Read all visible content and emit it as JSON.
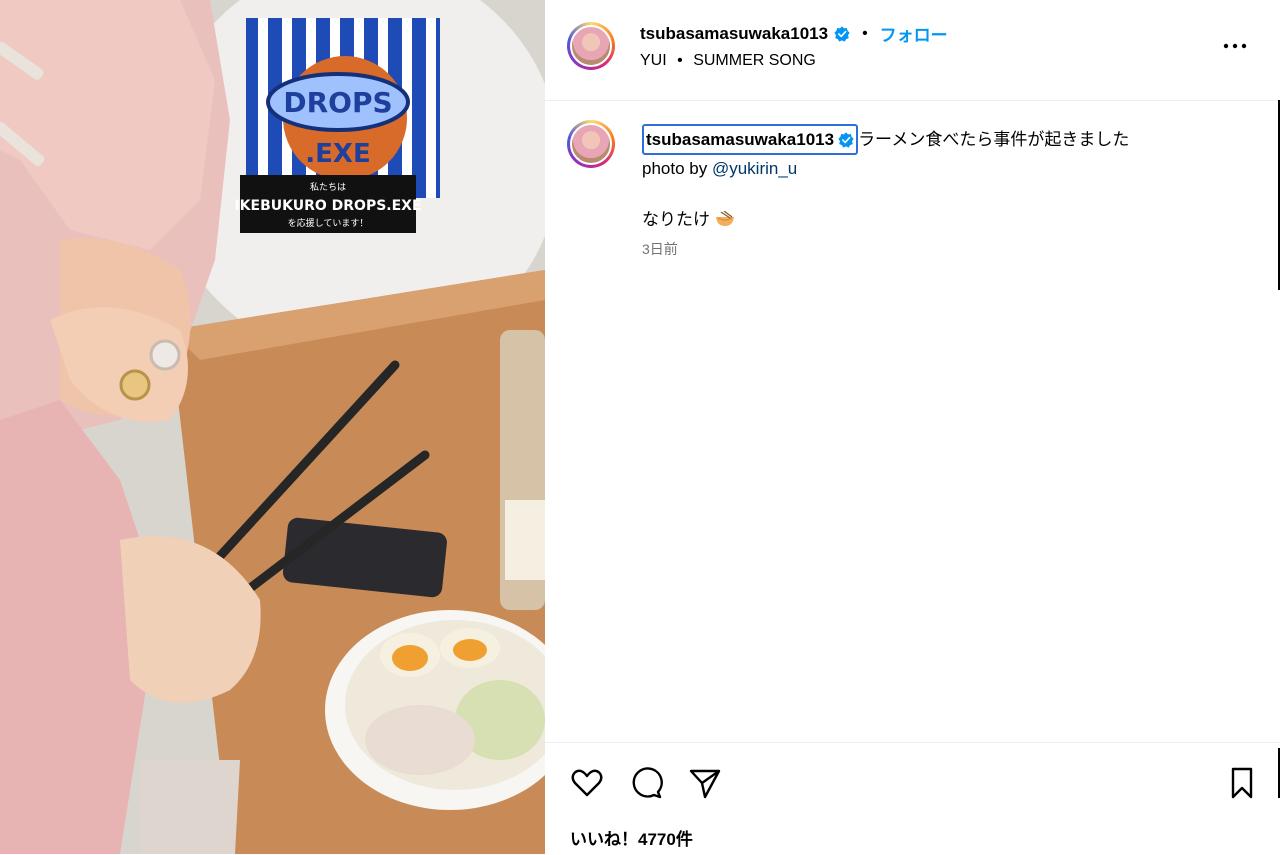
{
  "post": {
    "author": "tsubasamasuwaka1013",
    "follow_label": "フォロー",
    "separator": "•",
    "audio_artist": "YUI",
    "audio_song": "SUMMER SONG"
  },
  "caption": {
    "author": "tsubasamasuwaka1013",
    "text": "ラーメン食べたら事件が起きました",
    "photo_by_prefix": "photo by ",
    "mention": "@yukirin_u",
    "extra_text": "なりたけ",
    "time": "3日前"
  },
  "media": {
    "sign_text_1": "DROPS",
    "sign_text_2": ".EXE",
    "sign_text_3": "IKEBUKURO DROPS.EXE",
    "sign_text_4": "私たちは",
    "sign_text_5": "を応援しています！"
  },
  "actions": {
    "likes": "いいね！4770件"
  },
  "icons": [
    "verified-icon",
    "more-options-icon",
    "heart-icon",
    "comment-icon",
    "share-icon",
    "bookmark-icon",
    "ramen-emoji-icon"
  ],
  "colors": {
    "accent": "#0095f6",
    "mention": "#00376b",
    "verified": "#0095f6",
    "muted": "#737373"
  }
}
